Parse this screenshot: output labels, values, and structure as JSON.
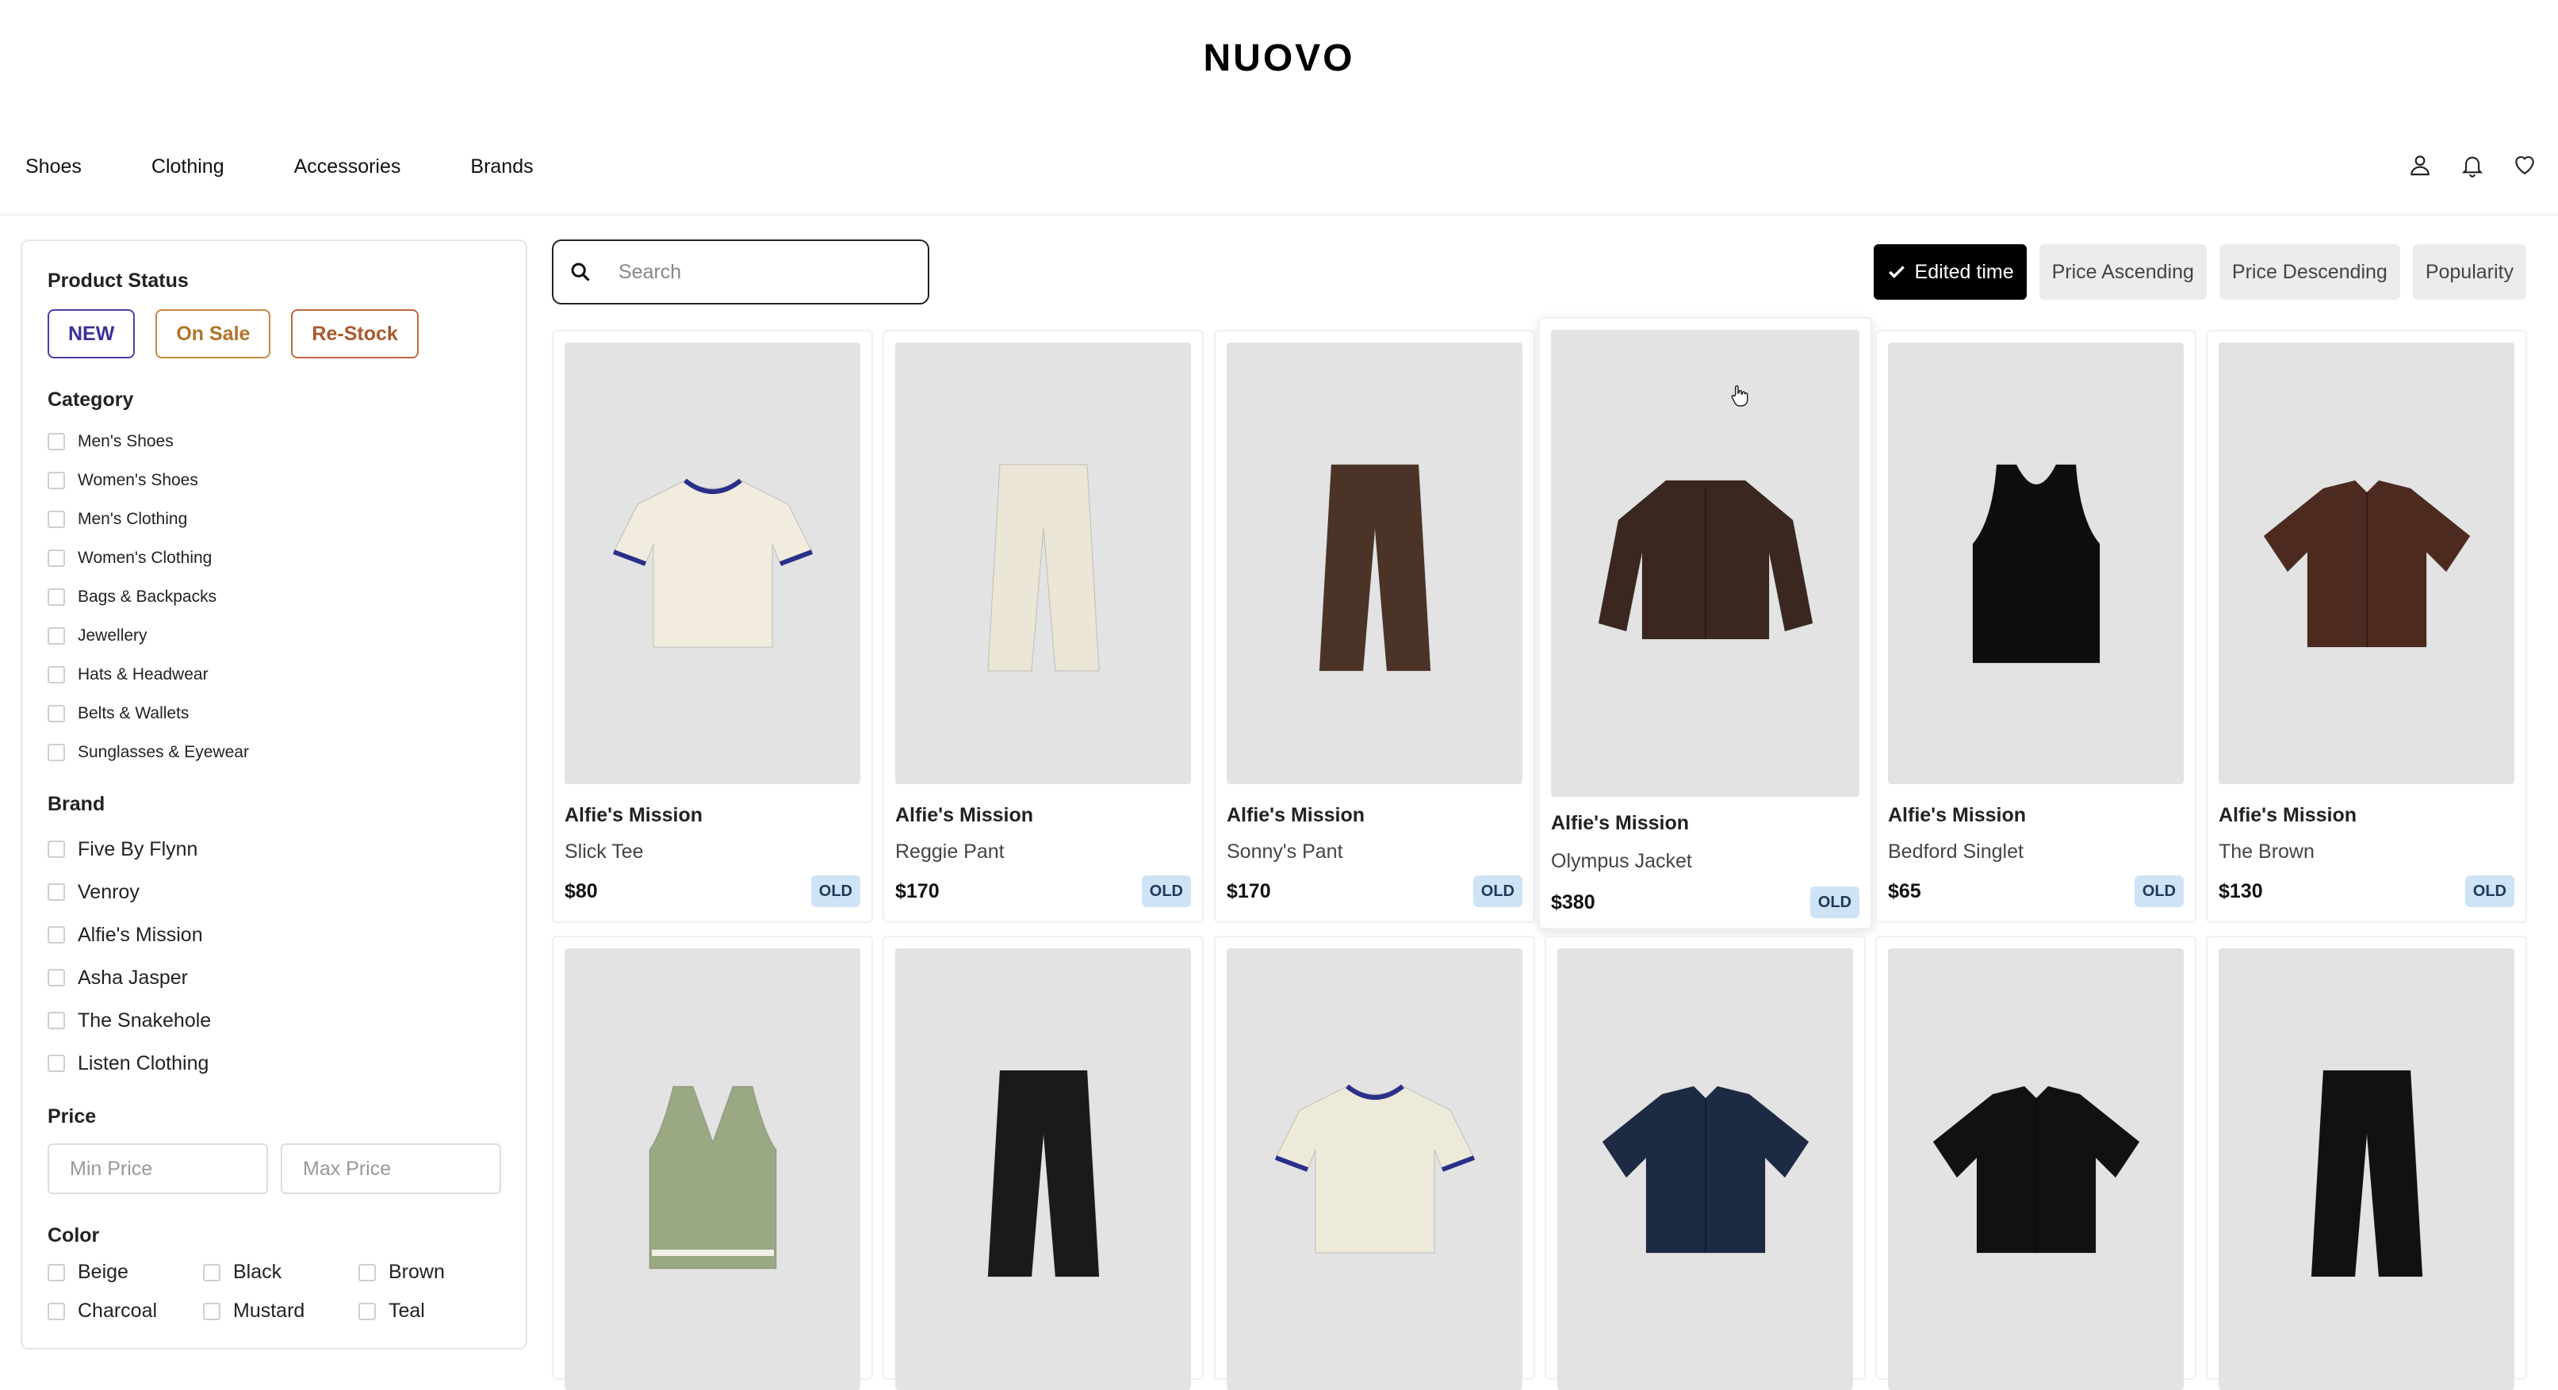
{
  "header": {
    "logo": "NUOVO"
  },
  "nav": {
    "items": [
      "Shoes",
      "Clothing",
      "Accessories",
      "Brands"
    ],
    "icons": [
      "user-icon",
      "bell-icon",
      "heart-icon"
    ]
  },
  "sidebar": {
    "product_status": {
      "title": "Product Status",
      "buttons": [
        {
          "label": "NEW",
          "color": "#3b3198"
        },
        {
          "label": "On Sale",
          "color": "#b0742a"
        },
        {
          "label": "Re-Stock",
          "color": "#a85a2c"
        }
      ]
    },
    "category": {
      "title": "Category",
      "items": [
        "Men's Shoes",
        "Women's Shoes",
        "Men's Clothing",
        "Women's Clothing",
        "Bags & Backpacks",
        "Jewellery",
        "Hats & Headwear",
        "Belts & Wallets",
        "Sunglasses & Eyewear"
      ]
    },
    "brand": {
      "title": "Brand",
      "items": [
        "Five By Flynn",
        "Venroy",
        "Alfie's Mission",
        "Asha Jasper",
        "The Snakehole",
        "Listen Clothing"
      ]
    },
    "price": {
      "title": "Price",
      "min_placeholder": "Min Price",
      "max_placeholder": "Max Price"
    },
    "color": {
      "title": "Color",
      "items": [
        "Beige",
        "Black",
        "Brown",
        "Charcoal",
        "Mustard",
        "Teal"
      ]
    }
  },
  "search": {
    "placeholder": "Search"
  },
  "sort": {
    "options": [
      {
        "label": "Edited time",
        "active": true
      },
      {
        "label": "Price Ascending",
        "active": false
      },
      {
        "label": "Price Descending",
        "active": false
      },
      {
        "label": "Popularity",
        "active": false
      }
    ]
  },
  "products": [
    {
      "brand": "Alfie's Mission",
      "name": "Slick Tee",
      "price": "$80",
      "tag": "OLD",
      "garment": "tee",
      "color": "#f1ecdd"
    },
    {
      "brand": "Alfie's Mission",
      "name": "Reggie Pant",
      "price": "$170",
      "tag": "OLD",
      "garment": "pant",
      "color": "#ece6d6"
    },
    {
      "brand": "Alfie's Mission",
      "name": "Sonny's Pant",
      "price": "$170",
      "tag": "OLD",
      "garment": "pant",
      "color": "#4b3427"
    },
    {
      "brand": "Alfie's Mission",
      "name": "Olympus Jacket",
      "price": "$380",
      "tag": "OLD",
      "garment": "jacket",
      "color": "#3a2820"
    },
    {
      "brand": "Alfie's Mission",
      "name": "Bedford Singlet",
      "price": "$65",
      "tag": "OLD",
      "garment": "singlet",
      "color": "#0e0e0e"
    },
    {
      "brand": "Alfie's Mission",
      "name": "The Brown",
      "price": "$130",
      "tag": "OLD",
      "garment": "shirt",
      "color": "#4d2a1f"
    }
  ],
  "products_row2": [
    {
      "garment": "vest",
      "color": "#9aa883"
    },
    {
      "garment": "pant",
      "color": "#1a1a1a"
    },
    {
      "garment": "tee",
      "color": "#eeead9"
    },
    {
      "garment": "shirt",
      "color": "#1c2a44"
    },
    {
      "garment": "shirt",
      "color": "#111111"
    },
    {
      "garment": "pant",
      "color": "#111111"
    }
  ]
}
